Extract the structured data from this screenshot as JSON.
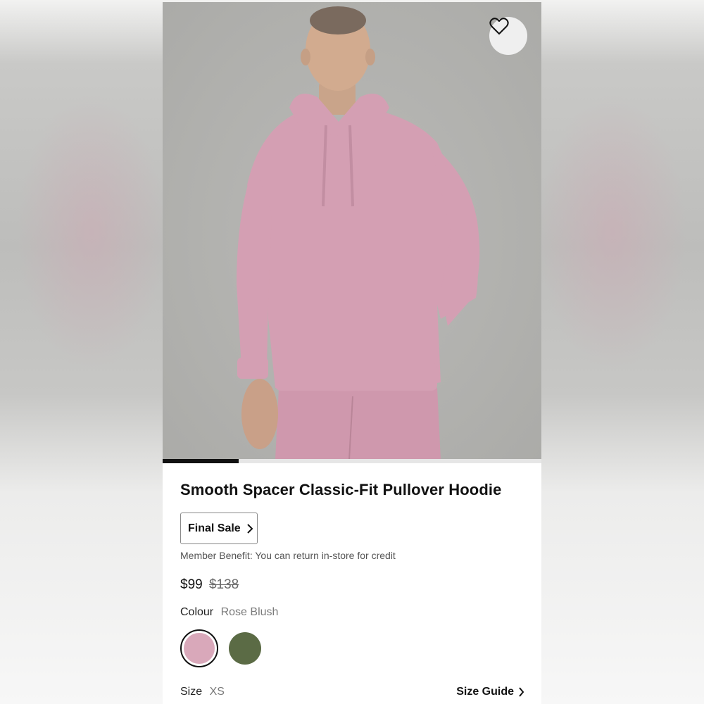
{
  "product": {
    "title": "Smooth Spacer Classic-Fit Pullover Hoodie",
    "final_sale_label": "Final Sale",
    "member_benefit": "Member Benefit: You can return in-store for credit",
    "price_current": "$99",
    "price_original": "$138",
    "colour_label": "Colour",
    "colour_value": "Rose Blush",
    "size_label": "Size",
    "size_value": "XS",
    "size_guide_label": "Size Guide"
  },
  "gallery": {
    "progress": 0.2
  },
  "colours": {
    "accent": "#111111",
    "hoodie": "#d49fb3",
    "swatch_rose": "#d9a8ba",
    "swatch_green": "#5b6b45"
  },
  "icons": {
    "favorite": "heart-outline-icon",
    "final_sale_chevron": "chevron-right-icon",
    "size_guide_chevron": "chevron-right-icon"
  }
}
